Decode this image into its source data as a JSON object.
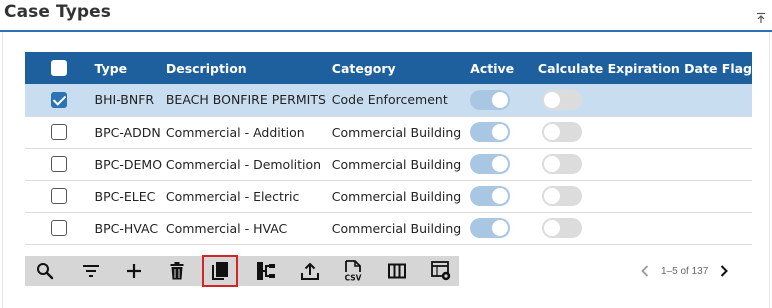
{
  "page": {
    "title": "Case Types"
  },
  "table": {
    "columns": [
      "Type",
      "Description",
      "Category",
      "Active",
      "Calculate Expiration Date Flag"
    ],
    "rows": [
      {
        "type": "BHI-BNFR",
        "description": "BEACH BONFIRE PERMITS",
        "category": "Code Enforcement",
        "selected": true,
        "active": true,
        "calc_flag": false
      },
      {
        "type": "BPC-ADDN",
        "description": "Commercial - Addition",
        "category": "Commercial Building",
        "selected": false,
        "active": true,
        "calc_flag": false
      },
      {
        "type": "BPC-DEMO",
        "description": "Commercial - Demolition",
        "category": "Commercial Building",
        "selected": false,
        "active": true,
        "calc_flag": false
      },
      {
        "type": "BPC-ELEC",
        "description": "Commercial - Electric",
        "category": "Commercial Building",
        "selected": false,
        "active": true,
        "calc_flag": false
      },
      {
        "type": "BPC-HVAC",
        "description": "Commercial - HVAC",
        "category": "Commercial Building",
        "selected": false,
        "active": true,
        "calc_flag": false
      }
    ]
  },
  "toolbar": {
    "buttons": [
      "search-icon",
      "filter-icon",
      "add-icon",
      "delete-icon",
      "copy-icon",
      "hierarchy-icon",
      "export-icon",
      "csv-icon",
      "columns-icon",
      "grid-settings-icon"
    ],
    "active_button": "copy-icon",
    "active_color": "#d0262a"
  },
  "pager": {
    "text": "1–5 of 137"
  },
  "colors": {
    "header_bg": "#1e5f9e",
    "accent": "#2b73b3",
    "selected_row": "#c9ddf0",
    "toolbar_bg": "#d6d6d6"
  }
}
